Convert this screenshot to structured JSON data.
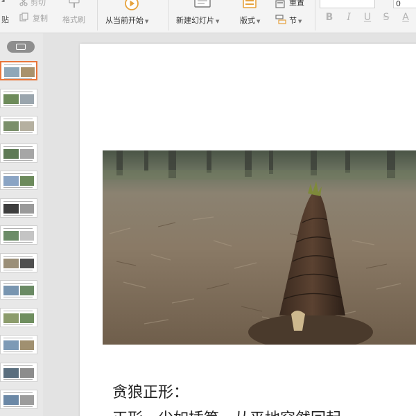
{
  "ribbon": {
    "cut_label": "剪切",
    "copy_label": "复制",
    "format_painter_label": "格式刷",
    "clipboard_tail_label": "贴",
    "from_current_label": "从当前开始",
    "new_slide_label": "新建幻灯片",
    "layout_label": "版式",
    "reset_label": "重置",
    "section_label": "节",
    "font_size_value": "0",
    "format_buttons": [
      "B",
      "I",
      "U",
      "S",
      "A"
    ]
  },
  "thumbnails": {
    "count": 14,
    "active_index": 1
  },
  "slide": {
    "photo_subject": "bamboo-shoot-photo",
    "heading": "贪狼正形：",
    "body_line": "正形，尖如插笋，从平地突然回起"
  },
  "colors": {
    "accent": "#e8763a",
    "ribbon_bg": "#f4f4f4",
    "panel_bg": "#e8e8e8"
  }
}
